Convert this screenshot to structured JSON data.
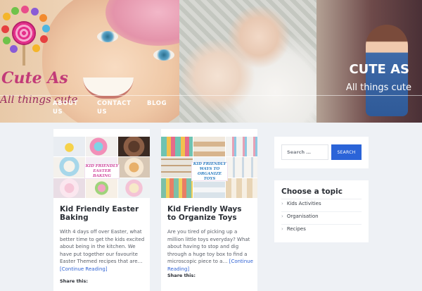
{
  "header": {
    "logo_text": "Cute As",
    "logo_tagline": "All things cute",
    "site_title": "CUTE AS",
    "site_tagline": "All things cute"
  },
  "nav": {
    "items": [
      {
        "label_line1": "ABOUT",
        "label_line2": "US"
      },
      {
        "label_line1": "CONTACT",
        "label_line2": "US"
      },
      {
        "label_line1": "BLOG",
        "label_line2": ""
      }
    ]
  },
  "posts": [
    {
      "image_caption_line1": "KID FRIENDLY",
      "image_caption_line2": "EASTER BAKING",
      "title": "Kid Friendly Easter Baking",
      "excerpt": "With 4 days off over Easter, what better time to get the kids excited about being in the kitchen.  We have put together our favourite Easter Themed recipes that are…",
      "read_more": "[Continue Reading]",
      "share_label": "Share this:"
    },
    {
      "image_caption_line1": "KID FRIENDLY",
      "image_caption_line2": "WAYS TO",
      "image_caption_line3": "ORGANIZE TOYS",
      "title": "Kid Friendly Ways to Organize Toys",
      "excerpt": "Are you tired of picking up a million little toys everyday? What about having to stop and dig through a huge toy box to find a microscopic piece to a…",
      "read_more": "[Continue Reading]",
      "share_label": "Share this:"
    }
  ],
  "sidebar": {
    "search": {
      "placeholder": "Search …",
      "button_label": "SEARCH"
    },
    "topics": {
      "title": "Choose a topic",
      "items": [
        "Kids Activities",
        "Organisation",
        "Recipes"
      ]
    }
  },
  "colors": {
    "accent": "#2b64d8",
    "logo_pink": "#c23b78",
    "page_bg": "#eef1f5"
  }
}
